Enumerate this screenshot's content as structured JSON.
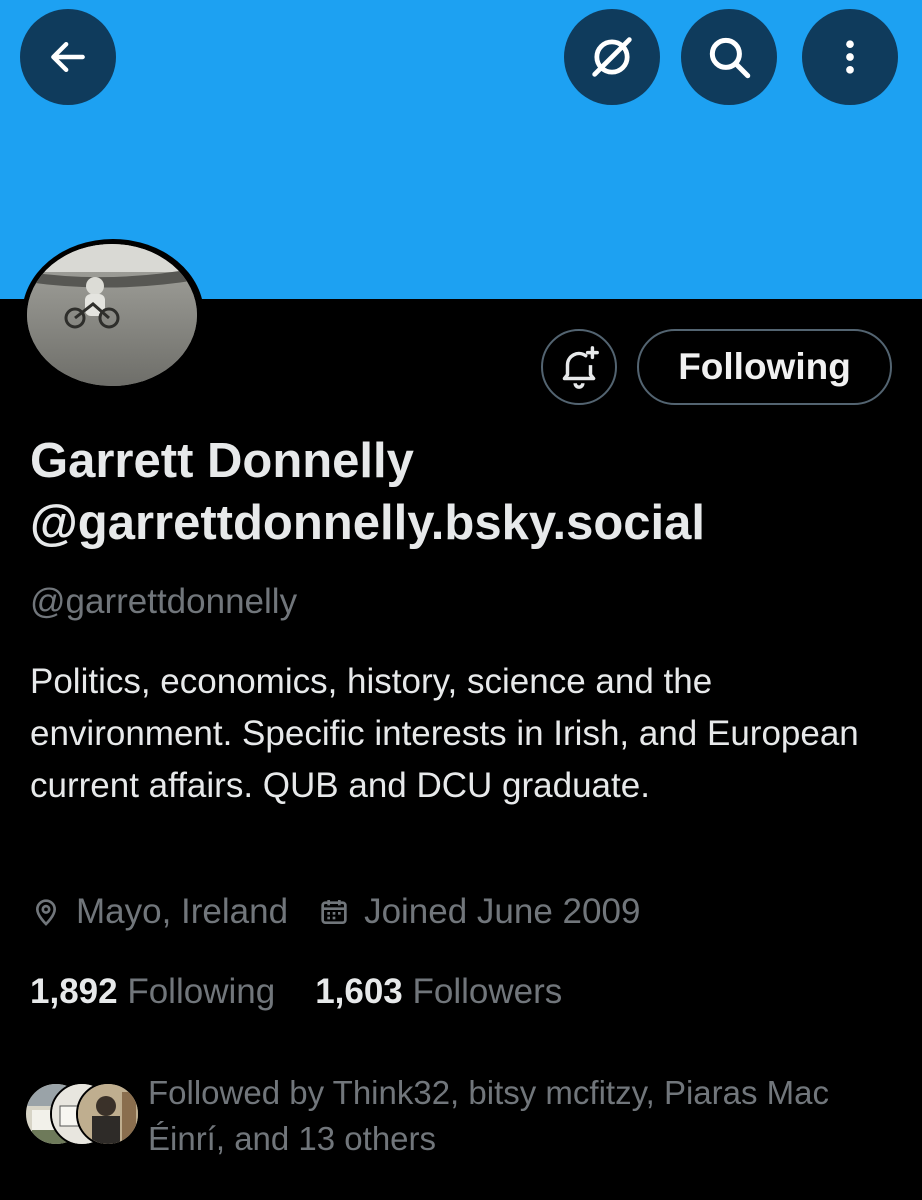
{
  "profile": {
    "display_name": "Garrett Donnelly @garrettdonnelly.bsky.social",
    "handle": "@garrettdonnelly",
    "bio": "Politics, economics, history, science and the environment. Specific interests in Irish, and European current affairs. QUB and DCU graduate.",
    "location": "Mayo, Ireland",
    "joined": "Joined June 2009",
    "following_count": "1,892",
    "following_label": "Following",
    "followers_count": "1,603",
    "followers_label": "Followers",
    "followed_by": "Followed by Think32, bitsy mcfitzy, Piaras Mac Éinrí, and 13 others"
  },
  "actions": {
    "follow_button_label": "Following"
  },
  "icons": {
    "back": "arrow-left-icon",
    "grok": "slashed-circle-icon",
    "search": "search-icon",
    "more": "more-vertical-icon",
    "notify": "bell-plus-icon",
    "location": "location-pin-icon",
    "calendar": "calendar-icon"
  },
  "colors": {
    "banner": "#1da1f2",
    "background": "#000000",
    "primary_text": "#e7e9ea",
    "secondary_text": "#71767b"
  }
}
